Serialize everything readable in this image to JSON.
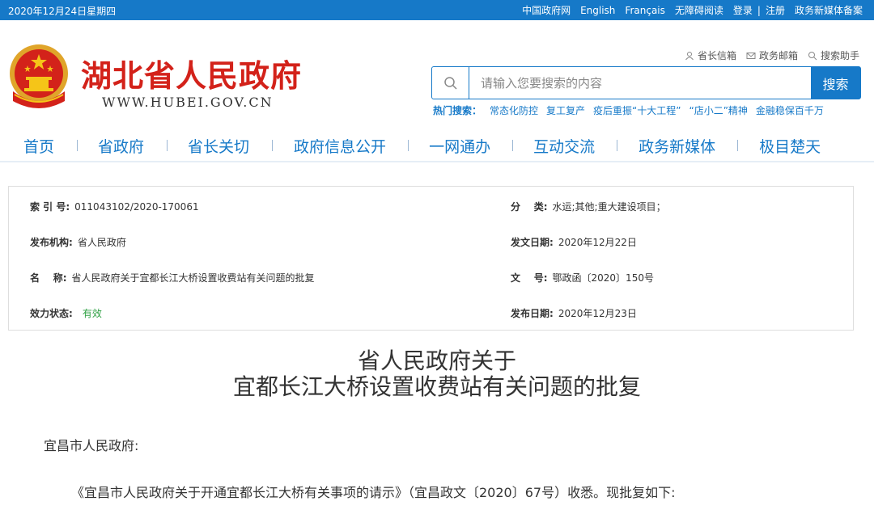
{
  "topbar": {
    "date": "2020年12月24日星期四",
    "links": [
      "中国政府网",
      "English",
      "Français",
      "无障碍阅读",
      "登录",
      "|",
      "注册",
      "政务新媒体备案"
    ]
  },
  "header": {
    "title": "湖北省人民政府",
    "domain": "WWW.HUBEI.GOV.CN",
    "quick_links": [
      "省长信箱",
      "政务邮箱",
      "搜索助手"
    ]
  },
  "search": {
    "placeholder": "请输入您要搜索的内容",
    "button": "搜索"
  },
  "hot_search": {
    "label": "热门搜索：",
    "items": [
      "常态化防控",
      "复工复产",
      "疫后重振“十大工程”",
      "“店小二”精神",
      "金融稳保百千万"
    ]
  },
  "nav": [
    "首页",
    "省政府",
    "省长关切",
    "政府信息公开",
    "一网通办",
    "互动交流",
    "政务新媒体",
    "极目楚天"
  ],
  "info": {
    "index_label": "索 引 号:",
    "index_value": "011043102/2020-170061",
    "category_label": "分    类:",
    "category_value": "水运;其他;重大建设项目；",
    "publisher_label": "发布机构:",
    "publisher_value": "省人民政府",
    "doc_date_label": "发文日期:",
    "doc_date_value": "2020年12月22日",
    "name_label": "名    称:",
    "name_value": "省人民政府关于宜都长江大桥设置收费站有关问题的批复",
    "doc_no_label": "文    号:",
    "doc_no_value": "鄂政函〔2020〕150号",
    "status_label": "效力状态:",
    "status_value": "有效",
    "pub_date_label": "发布日期:",
    "pub_date_value": "2020年12月23日"
  },
  "document": {
    "title_line1": "省人民政府关于",
    "title_line2": "宜都长江大桥设置收费站有关问题的批复",
    "salutation": "宜昌市人民政府:",
    "body": "《宜昌市人民政府关于开通宜都长江大桥有关事项的请示》（宜昌政文〔2020〕67号）收悉。现批复如下:"
  },
  "colors": {
    "primary": "#1679c8",
    "title_red": "#d3221a",
    "status_green": "#2ea043"
  }
}
